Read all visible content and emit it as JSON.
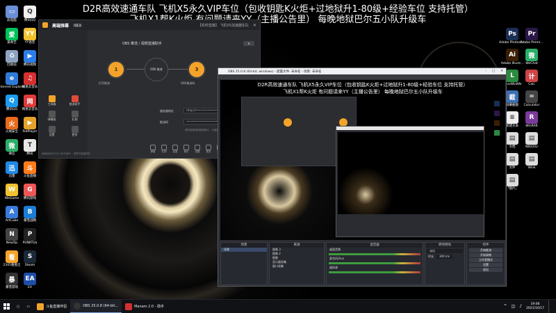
{
  "overlay": {
    "line1": "D2R高效速通车队 飞机X5永久VIP车位（包收钥匙K火炬+过地狱升1-80级+经验车位 支持托管）",
    "line2": "飞机X1帮K火炬 有问题请来YY（主播公告里） 每晚地狱巴尔五小队升级车"
  },
  "desktop_icons_left": [
    {
      "label": "此电脑",
      "color": "#6a8fd8",
      "glyph": "▭"
    },
    {
      "label": "腾讯QQ",
      "color": "#f0f0f0",
      "glyph": "Q"
    },
    {
      "label": "爱奇艺",
      "color": "#00c15a",
      "glyph": "爱"
    },
    {
      "label": "YY语音",
      "color": "#f1c230",
      "glyph": "YY"
    },
    {
      "label": "回收站",
      "color": "#8da3bf",
      "glyph": "♻"
    },
    {
      "label": "腾讯视频",
      "color": "#2b7ee8",
      "glyph": "▶"
    },
    {
      "label": "Internet Explorer",
      "color": "#2f7ad8",
      "glyph": "e"
    },
    {
      "label": "网易云音乐",
      "color": "#d53030",
      "glyph": "♫"
    },
    {
      "label": "腾讯QQ",
      "color": "#1d9bf0",
      "glyph": "Q"
    },
    {
      "label": "网易云音乐",
      "color": "#e03a3a",
      "glyph": "网"
    },
    {
      "label": "火绒安全",
      "color": "#e86a1a",
      "glyph": "火"
    },
    {
      "label": "PotPlayer",
      "color": "#e4a22b",
      "glyph": "▶"
    },
    {
      "label": "微信",
      "color": "#2aae67",
      "glyph": "微"
    },
    {
      "label": "腾讯",
      "color": "#e8e8e8",
      "glyph": "T"
    },
    {
      "label": "迅雷",
      "color": "#1e88e5",
      "glyph": "迅"
    },
    {
      "label": "斗鱼直播",
      "color": "#ff7a1a",
      "glyph": "斗"
    },
    {
      "label": "WeGame",
      "color": "#f1c230",
      "glyph": "W"
    },
    {
      "label": "腾讯游戏",
      "color": "#e55",
      "glyph": "G"
    },
    {
      "label": "ArtCube",
      "color": "#3a7ad8",
      "glyph": "A"
    },
    {
      "label": "暴雪战网",
      "color": "#1b7dd6",
      "glyph": "B"
    },
    {
      "label": "NewOp",
      "color": "#444",
      "glyph": "N"
    },
    {
      "label": "PUNKTUa",
      "color": "#222",
      "glyph": "P"
    },
    {
      "label": "2345看图王",
      "color": "#f4a32a",
      "glyph": "看"
    },
    {
      "label": "Steam",
      "color": "#1b2838",
      "glyph": "S"
    },
    {
      "label": "暴雪游戏",
      "color": "#333",
      "glyph": "暴"
    },
    {
      "label": "EA",
      "color": "#1d4ea8",
      "glyph": "EA"
    }
  ],
  "desktop_icons_right": [
    {
      "label": "Adobe Photosh...",
      "color": "#1a2f55",
      "glyph": "Ps"
    },
    {
      "label": "Adobe Premi...",
      "color": "#2a1847",
      "glyph": "Pr"
    },
    {
      "label": "Adobe Illustr...",
      "color": "#3b1f04",
      "glyph": "Ai"
    },
    {
      "label": "WeChat",
      "color": "#2aae67",
      "glyph": "微"
    },
    {
      "label": "LoveWinNN",
      "color": "#2b8a3e",
      "glyph": "L"
    },
    {
      "label": "Calc",
      "color": "#c44",
      "glyph": "计"
    },
    {
      "label": "屏幕截图",
      "color": "#3c6fb0",
      "glyph": "截"
    },
    {
      "label": "Calculator",
      "color": "#444",
      "glyph": "="
    },
    {
      "label": "新建文本",
      "color": "#eee",
      "glyph": "≡"
    },
    {
      "label": "WinRAR",
      "color": "#7a3a9a",
      "glyph": "R"
    },
    {
      "label": "文档",
      "color": "#ddd",
      "glyph": "▤"
    },
    {
      "label": "NB0202",
      "color": "#ddd",
      "glyph": "▤"
    },
    {
      "label": "文件",
      "color": "#ddd",
      "glyph": "▤"
    },
    {
      "label": "Wink",
      "color": "#ddd",
      "glyph": "▤"
    },
    {
      "label": "「图片」",
      "color": "#ddd",
      "glyph": "▤"
    }
  ],
  "app_window": {
    "title": "高端弹幕",
    "version": "V2.3",
    "header_info": "【实时直播】 飞机X5加速器车队",
    "sidebar_items": [
      "工具箱",
      "推流助手",
      "弹幕姬",
      "礼物",
      "设置",
      "更多"
    ],
    "nodes": [
      {
        "name": "打开推流",
        "num": "1"
      },
      {
        "name": "OBS 推流",
        "num": "2"
      },
      {
        "name": "OBS推流码",
        "num": "3"
      }
    ],
    "center_text": "OBS 推流 / 视频直播助手",
    "server_label": "服务器地址",
    "server_value": "rtmp://••••••••••••••••••••••••••••",
    "key_label": "推流码",
    "key_value": "••••••••••••••••••••••••••••••••••",
    "copy_label": "复制",
    "notice": "请勿将推流码告知他人，以免直播间被盗用",
    "footer_tools": [
      "弹幕",
      "礼物",
      "连麦",
      "音乐",
      "设置",
      "更多",
      "清屏",
      "分享"
    ],
    "footer_note": "每晚地狱巴尔五小队升级车 · 请遵守直播规范"
  },
  "obs_window": {
    "title": "OBS 25.0.8 (64-bit, windows) - 配置文件: 未命名 - 场景: 未命名",
    "docks": {
      "scenes": {
        "title": "场景",
        "items": [
          "场景"
        ]
      },
      "sources": {
        "title": "来源",
        "items": [
          "图像 3",
          "图像 2",
          "图像",
          "显示器采集",
          "窗口采集"
        ]
      },
      "mixer": {
        "title": "混音器",
        "channels": [
          "桌面音频",
          "麦克风/Aux",
          "媒体源"
        ]
      },
      "transitions": {
        "title": "转场特效",
        "type": "淡出",
        "duration_label": "时长",
        "duration": "300 ms"
      },
      "controls": {
        "title": "控件",
        "buttons": [
          "开始推流",
          "开始录制",
          "工作室模式",
          "设置",
          "退出"
        ]
      }
    }
  },
  "taskbar": {
    "items": [
      {
        "label": "斗鱼直播伴侣",
        "color": "#f4a32a",
        "active": false
      },
      {
        "label": "OBS 25.0.8 (64-bit...",
        "color": "#333",
        "active": true
      },
      {
        "label": "Manam 2.0 - 助手",
        "color": "#d53030",
        "active": false
      }
    ],
    "time": "19:06",
    "date": "2021/10/17"
  }
}
